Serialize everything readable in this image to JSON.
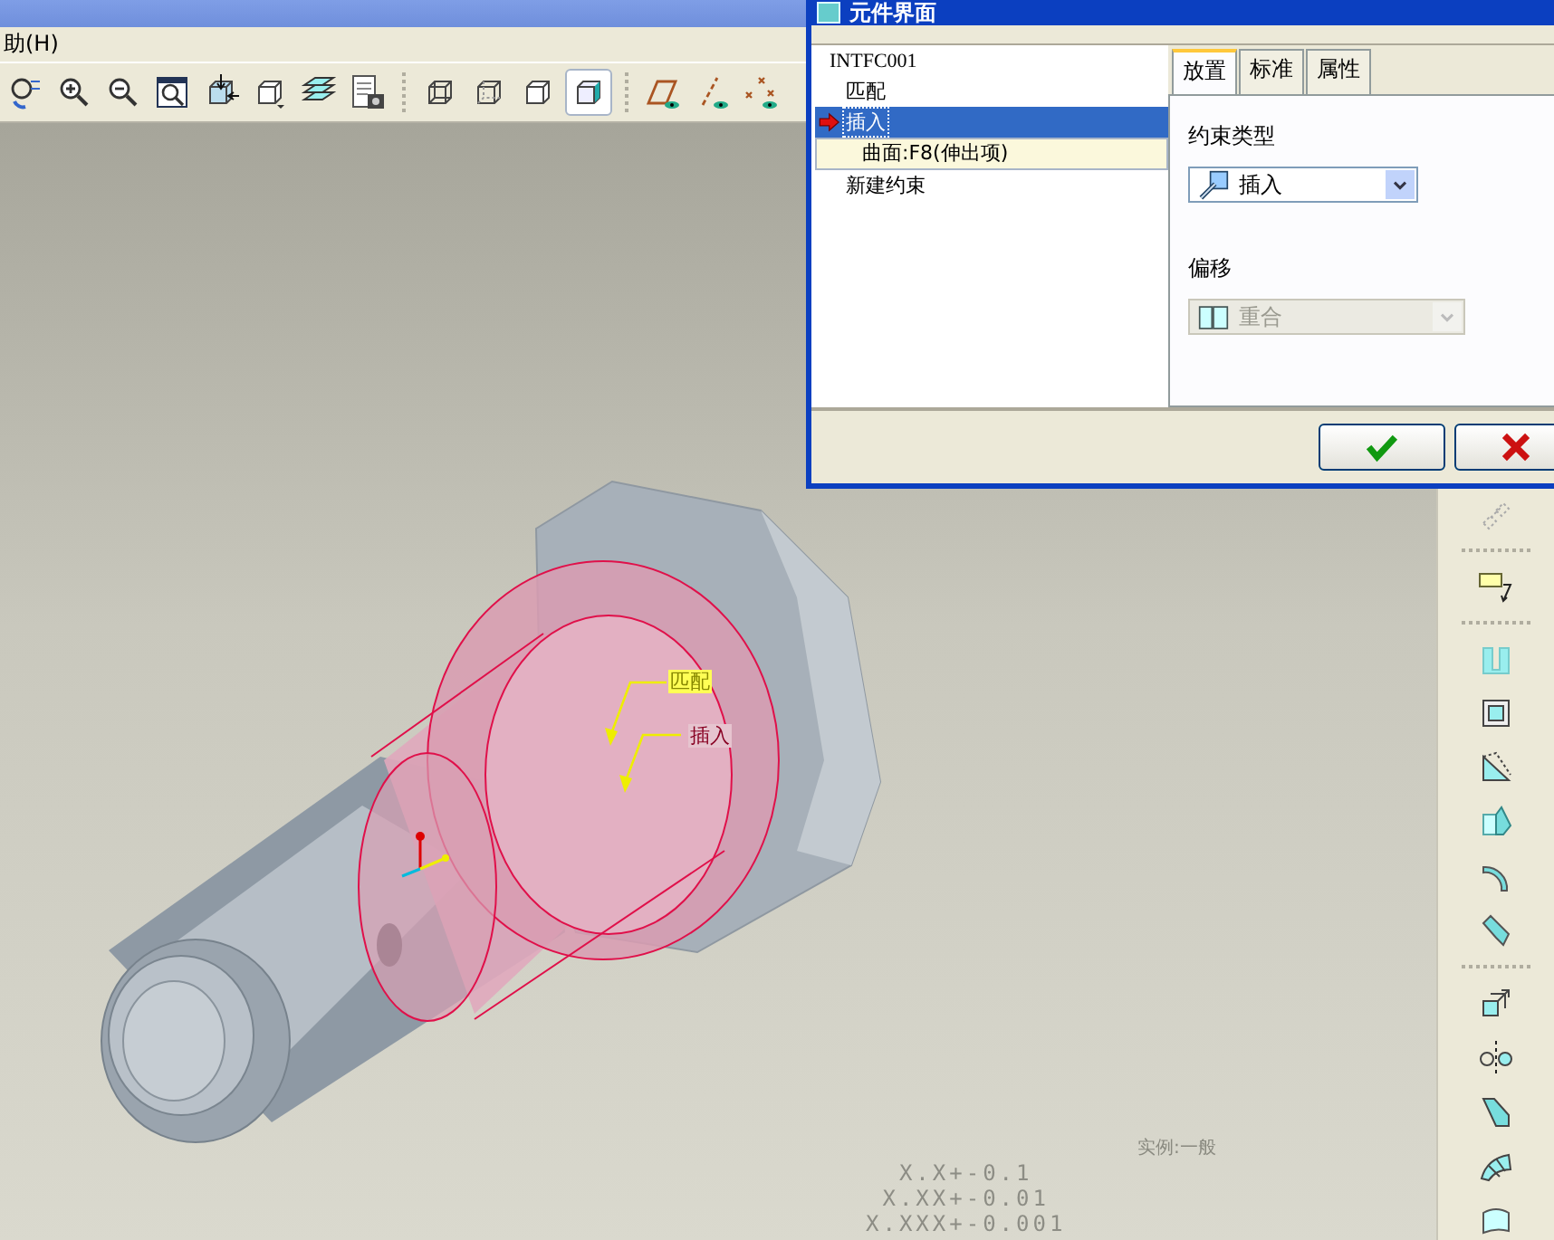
{
  "menu_bar": {
    "fragment": "助(H)"
  },
  "dialog": {
    "title": "元件界面",
    "tree": {
      "root": "INTFC001",
      "items": [
        {
          "label": "匹配",
          "selected": false,
          "current": false
        },
        {
          "label": "插入",
          "selected": true,
          "current": true,
          "children": [
            {
              "label": "曲面:F8(伸出项)",
              "highlighted": true
            }
          ]
        },
        {
          "label": "新建约束",
          "selected": false,
          "current": false
        }
      ]
    },
    "tabs": [
      {
        "label": "放置",
        "selected": true
      },
      {
        "label": "标准",
        "selected": false
      },
      {
        "label": "属性",
        "selected": false
      }
    ],
    "constraint_type": {
      "label": "约束类型",
      "value": "插入",
      "disabled": false
    },
    "offset": {
      "label": "偏移",
      "value": "重合",
      "disabled": true
    },
    "buttons": [
      {
        "kind": "ok"
      },
      {
        "kind": "cancel"
      }
    ]
  },
  "viewport": {
    "annotations": [
      {
        "text": "匹配",
        "highlighted": true
      },
      {
        "text": "插入",
        "highlighted": false
      }
    ],
    "instance_note": "实例:一般",
    "tolerances": [
      "X.X+-0.1",
      "X.XX+-0.01",
      "X.XXX+-0.001"
    ]
  }
}
